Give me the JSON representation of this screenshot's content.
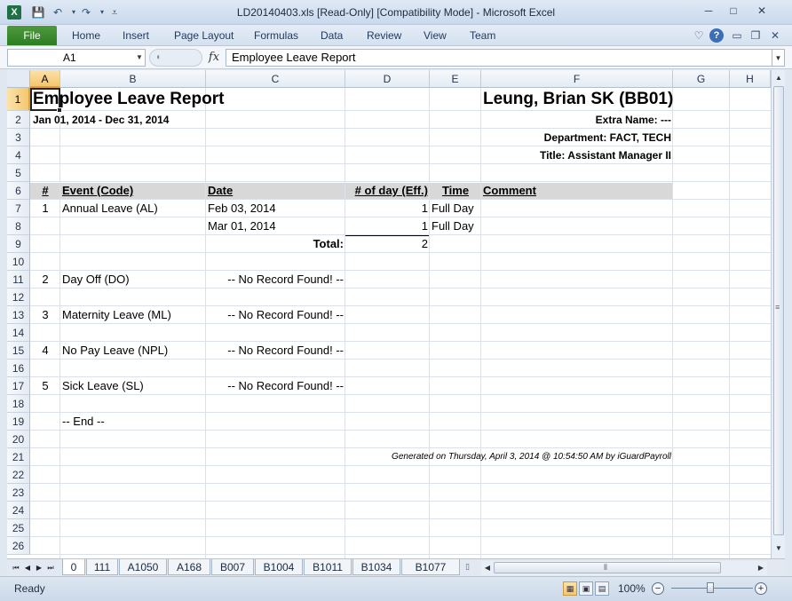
{
  "window": {
    "title": "LD20140403.xls  [Read-Only]  [Compatibility Mode]  -  Microsoft Excel",
    "app_icon": "X",
    "qa_icons": [
      "save-icon",
      "undo-icon",
      "redo-icon",
      "customize-icon"
    ],
    "controls": {
      "minimize": "─",
      "maximize": "□",
      "close": "✕"
    }
  },
  "ribbon": {
    "file": "File",
    "tabs": [
      "Home",
      "Insert",
      "Page Layout",
      "Formulas",
      "Data",
      "Review",
      "View",
      "Team"
    ],
    "help": "?"
  },
  "formula_bar": {
    "cell_ref": "A1",
    "fx": "fx",
    "formula": "Employee Leave Report"
  },
  "grid": {
    "columns": [
      "A",
      "B",
      "C",
      "D",
      "E",
      "F",
      "G",
      "H"
    ],
    "rows": [
      "1",
      "2",
      "3",
      "4",
      "5",
      "6",
      "7",
      "8",
      "9",
      "10",
      "11",
      "12",
      "13",
      "14",
      "15",
      "16",
      "17",
      "18",
      "19",
      "20",
      "21",
      "22",
      "23",
      "24",
      "25",
      "26"
    ],
    "selected_cell": "A1"
  },
  "report": {
    "title": "Employee Leave Report",
    "period": "Jan 01, 2014 - Dec 31, 2014",
    "employee": "Leung, Brian SK (BB01)",
    "extra_name": "Extra Name: ---",
    "department": "Department: FACT, TECH",
    "job_title": "Title: Assistant Manager II",
    "headers": {
      "num": "#",
      "event": "Event (Code)",
      "date": "Date",
      "days": "# of day (Eff.)",
      "time": "Time",
      "comment": "Comment"
    },
    "events": [
      {
        "num": "1",
        "event": "Annual Leave (AL)"
      },
      {
        "num": "2",
        "event": "Day Off (DO)",
        "note": "-- No Record Found! --"
      },
      {
        "num": "3",
        "event": "Maternity Leave (ML)",
        "note": "-- No Record Found! --"
      },
      {
        "num": "4",
        "event": "No Pay Leave (NPL)",
        "note": "-- No Record Found! --"
      },
      {
        "num": "5",
        "event": "Sick Leave (SL)",
        "note": "-- No Record Found! --"
      }
    ],
    "annual_rows": [
      {
        "date": "Feb 03, 2014",
        "days": "1",
        "time": "Full Day"
      },
      {
        "date": "Mar 01, 2014",
        "days": "1",
        "time": "Full Day"
      }
    ],
    "total_label": "Total:",
    "total_value": "2",
    "end": "-- End --",
    "generated": "Generated on Thursday, April 3, 2014 @ 10:54:50 AM by iGuardPayroll"
  },
  "sheets": [
    "0",
    "111",
    "A1050",
    "A168",
    "B007",
    "B1004",
    "B1011",
    "B1034",
    "B1077"
  ],
  "status": {
    "ready": "Ready",
    "zoom": "100%",
    "zoom_out": "−",
    "zoom_in": "+"
  }
}
